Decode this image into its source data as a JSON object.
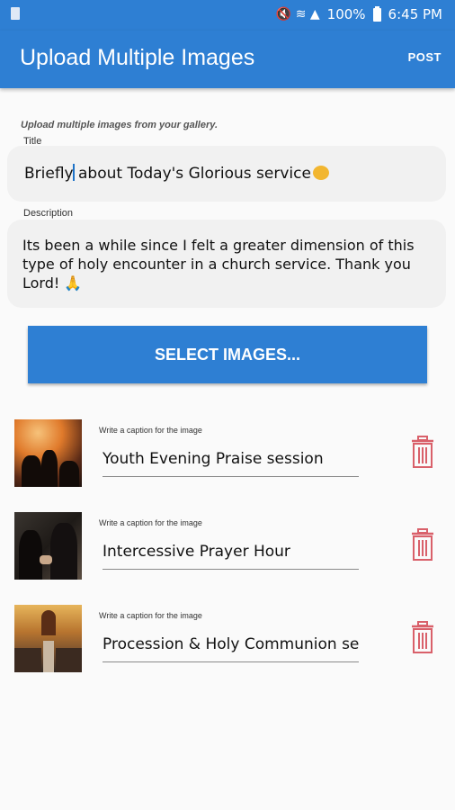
{
  "status_bar": {
    "battery_text": "100%",
    "time": "6:45 PM",
    "signal_glyphs": "🔇 ≋ ▲"
  },
  "app_bar": {
    "title": "Upload Multiple Images",
    "post_label": "POST"
  },
  "form": {
    "hint": "Upload multiple images from your gallery.",
    "title_label": "Title",
    "title_value_before_cursor": "Briefly",
    "title_value_after_cursor": " about Today's Glorious service",
    "description_label": "Description",
    "description_value": "Its been a while since I felt a greater dimension of this type of holy encounter in a church service. Thank you Lord! 🙏"
  },
  "select_button_label": "SELECT IMAGES...",
  "images": [
    {
      "caption_label": "Write a caption for the image",
      "caption_value": "Youth Evening Praise session",
      "icon": "trash-icon"
    },
    {
      "caption_label": "Write a caption for the image",
      "caption_value": "Intercessive Prayer Hour",
      "icon": "trash-icon"
    },
    {
      "caption_label": "Write a caption for the image",
      "caption_value": "Procession & Holy Communion serv",
      "icon": "trash-icon"
    }
  ],
  "colors": {
    "primary": "#2e7fd3",
    "trash": "#d9606a"
  }
}
